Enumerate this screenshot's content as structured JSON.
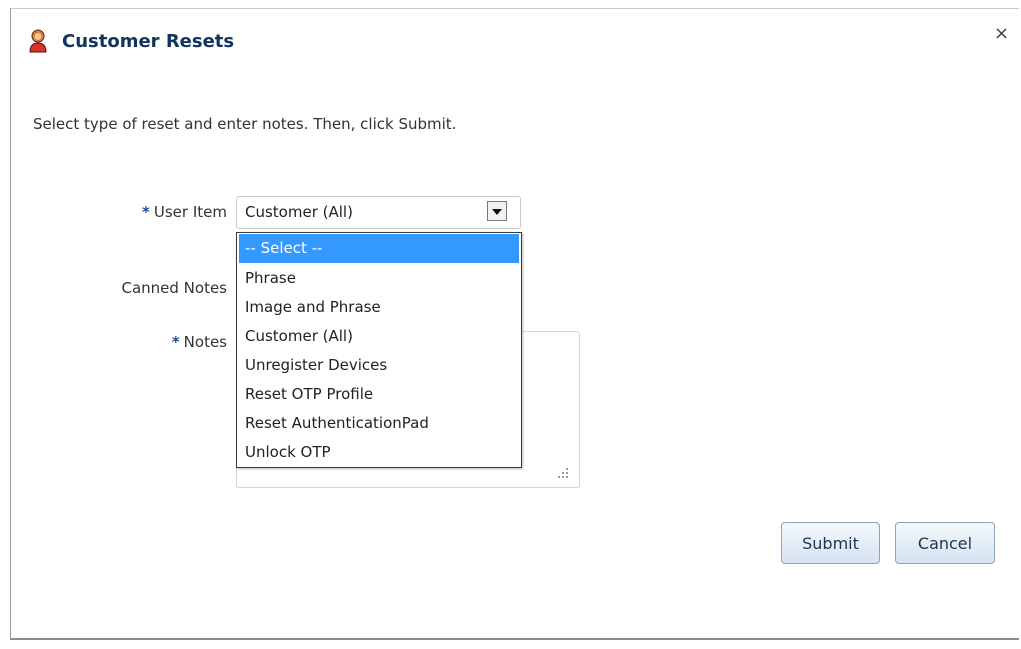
{
  "dialog": {
    "title": "Customer Resets",
    "close_glyph": "×",
    "icon": "user-icon",
    "instructions": "Select type of reset and enter notes. Then, click Submit."
  },
  "form": {
    "required_marker": "*",
    "user_item": {
      "label": "User Item",
      "selected": "Customer (All)",
      "options": [
        "-- Select --",
        "Phrase",
        "Image and Phrase",
        "Customer (All)",
        "Unregister Devices",
        "Reset OTP Profile",
        "Reset AuthenticationPad",
        "Unlock OTP"
      ],
      "highlighted_option": "-- Select --"
    },
    "canned_notes": {
      "label": "Canned Notes"
    },
    "notes": {
      "label": "Notes",
      "value": ""
    }
  },
  "buttons": {
    "submit": "Submit",
    "cancel": "Cancel"
  },
  "colors": {
    "title": "#12335c",
    "required": "#1a4f93",
    "highlight": "#3399ff"
  }
}
